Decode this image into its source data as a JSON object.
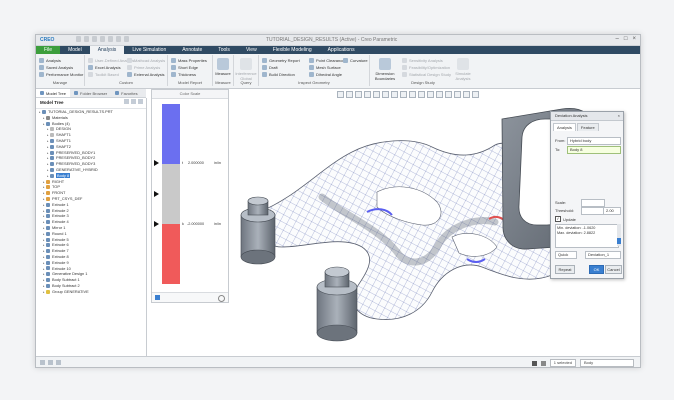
{
  "app": {
    "name": "CREO",
    "title": "TUTORIAL_DESIGN_RESULTS (Active) - Creo Parametric"
  },
  "ribbon_tabs": [
    "File",
    "Model",
    "Analysis",
    "Live Simulation",
    "Annotate",
    "Tools",
    "View",
    "Flexible Modeling",
    "Applications"
  ],
  "ribbon": {
    "manage": {
      "label": "Manage",
      "items": [
        "Analysis",
        "Saved Analysis",
        "Performance Monitor"
      ]
    },
    "custom": {
      "label": "Custom",
      "items": [
        "User-Defined Analysis",
        "Excel Analysis",
        "Toolkit Based",
        "Mathcad Analysis",
        "Prime Analysis",
        "External Analysis"
      ]
    },
    "model_report": {
      "label": "Model Report",
      "items": [
        "Mass Properties",
        "Short Edge",
        "Thickness"
      ]
    },
    "measure": {
      "label": "Measure",
      "button": "Measure"
    },
    "query": {
      "label": "Query",
      "button": "Interference Global"
    },
    "inspect": {
      "label": "Inspect Geometry",
      "items": [
        "Geometry Report",
        "Draft",
        "Build Direction",
        "Point Clearance",
        "Mesh Surface",
        "Dihedral Angle",
        "Curvature"
      ]
    },
    "design_study": {
      "label": "Design Study",
      "big": "Dimension Boundaries",
      "items": [
        "Sensitivity Analysis",
        "Feasibility/Optimization",
        "Statistical Design Study"
      ],
      "btn2": "Simulate Analysis"
    }
  },
  "panel_tabs": [
    "Model Tree",
    "Folder Browser",
    "Favorites"
  ],
  "model_tree": {
    "header": "Model Tree",
    "items": [
      {
        "label": "TUTORIAL_DESIGN_RESULTS.PRT",
        "level": 0,
        "color": "#6b8fb8"
      },
      {
        "label": "Materials",
        "level": 1,
        "color": "#8a8a8a"
      },
      {
        "label": "Bodies (4)",
        "level": 1,
        "color": "#6b8fb8"
      },
      {
        "label": "DESIGN",
        "level": 2,
        "color": "#bbbbbb"
      },
      {
        "label": "SHAFT1",
        "level": 2,
        "color": "#bbbbbb"
      },
      {
        "label": "SHAFT1",
        "level": 2,
        "color": "#6b8fb8"
      },
      {
        "label": "SHAFT2",
        "level": 2,
        "color": "#6b8fb8"
      },
      {
        "label": "PRESERVED_BODY1",
        "level": 2,
        "color": "#6b8fb8"
      },
      {
        "label": "PRESERVED_BODY2",
        "level": 2,
        "color": "#6b8fb8"
      },
      {
        "label": "PRESERVED_BODY3",
        "level": 2,
        "color": "#6b8fb8"
      },
      {
        "label": "GENERATIVE_HYBRID",
        "level": 2,
        "color": "#6b8fb8"
      },
      {
        "label": "Body 8",
        "level": 2,
        "color": "#6b8fb8",
        "selected": true
      },
      {
        "label": "RIGHT",
        "level": 1,
        "color": "#e0a040"
      },
      {
        "label": "TOP",
        "level": 1,
        "color": "#e0a040"
      },
      {
        "label": "FRONT",
        "level": 1,
        "color": "#e0a040"
      },
      {
        "label": "PRT_CSYS_DEF",
        "level": 1,
        "color": "#e0a040"
      },
      {
        "label": "Extrude 1",
        "level": 1,
        "color": "#6b8fb8"
      },
      {
        "label": "Extrude 2",
        "level": 1,
        "color": "#6b8fb8"
      },
      {
        "label": "Extrude 3",
        "level": 1,
        "color": "#6b8fb8"
      },
      {
        "label": "Extrude 4",
        "level": 1,
        "color": "#6b8fb8"
      },
      {
        "label": "Mirror 1",
        "level": 1,
        "color": "#6b8fb8"
      },
      {
        "label": "Round 1",
        "level": 1,
        "color": "#6b8fb8"
      },
      {
        "label": "Extrude 5",
        "level": 1,
        "color": "#6b8fb8"
      },
      {
        "label": "Extrude 6",
        "level": 1,
        "color": "#6b8fb8"
      },
      {
        "label": "Extrude 7",
        "level": 1,
        "color": "#6b8fb8"
      },
      {
        "label": "Extrude 8",
        "level": 1,
        "color": "#6b8fb8"
      },
      {
        "label": "Extrude 9",
        "level": 1,
        "color": "#6b8fb8"
      },
      {
        "label": "Extrude 10",
        "level": 1,
        "color": "#6b8fb8"
      },
      {
        "label": "Generative Design 1",
        "level": 1,
        "color": "#6b8fb8"
      },
      {
        "label": "Body Subtract 1",
        "level": 1,
        "color": "#6b8fb8"
      },
      {
        "label": "Body Subtract 2",
        "level": 1,
        "color": "#6b8fb8"
      },
      {
        "label": "Group GENERATIVE",
        "level": 1,
        "color": "#e0c040"
      }
    ]
  },
  "color_scale": {
    "title": "Color Scale",
    "top_value": "2.000000",
    "top_unit": "in/in",
    "bottom_value": "-2.000000",
    "bottom_unit": "in/in",
    "colors": {
      "top": "#6b6ff0",
      "middle": "#c9c9c9",
      "bottom": "#f05a5a"
    }
  },
  "dialog": {
    "title": "Deviation Analysis",
    "tabs": [
      "Analysis",
      "Feature"
    ],
    "from_label": "From:",
    "from_value": "Hybrid body",
    "to_label": "To:",
    "to_value": "Body 8",
    "scale_label": "Scale:",
    "threshold_label": "Threshold:",
    "threshold_value": "2.00",
    "update_label": "Update",
    "result_line1": "Min. deviation: -1.0620",
    "result_line2": "Max. deviation: 2.8822",
    "quick": "Quick",
    "analysis_name": "Deviation_1",
    "buttons": {
      "repeat": "Repeat",
      "ok": "OK",
      "cancel": "Cancel"
    }
  },
  "status": {
    "selected": "1 selected",
    "filter": "Body"
  }
}
